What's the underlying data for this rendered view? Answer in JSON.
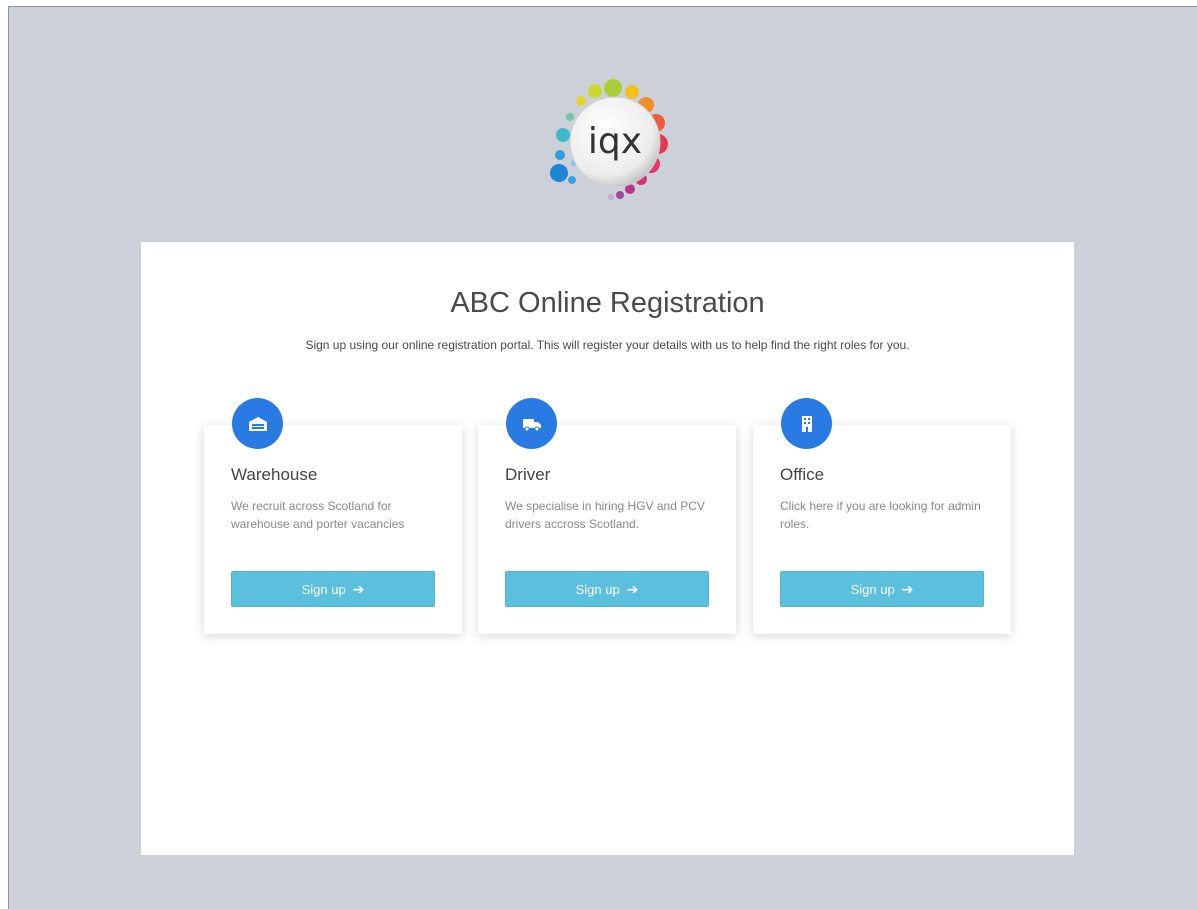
{
  "page": {
    "background_color": "#ccd0d9",
    "accent_color": "#2a7ae4",
    "button_color": "#5bc0de"
  },
  "logo": {
    "text": "iqx",
    "icon": "iqx-logo"
  },
  "main": {
    "title": "ABC Online Registration",
    "subtitle": "Sign up using our online registration portal. This will register your details with us to help find the right roles for you."
  },
  "cards": [
    {
      "icon": "warehouse-icon",
      "title": "Warehouse",
      "description": "We recruit across Scotland for warehouse and porter vacancies",
      "button_label": "Sign up",
      "button_icon": "arrow-right-icon"
    },
    {
      "icon": "truck-icon",
      "title": "Driver",
      "description": "We specialise in hiring HGV and PCV drivers accross Scotland.",
      "button_label": "Sign up",
      "button_icon": "arrow-right-icon"
    },
    {
      "icon": "office-building-icon",
      "title": "Office",
      "description": "Click here if you are looking for admin roles.",
      "button_label": "Sign up",
      "button_icon": "arrow-right-icon"
    }
  ]
}
